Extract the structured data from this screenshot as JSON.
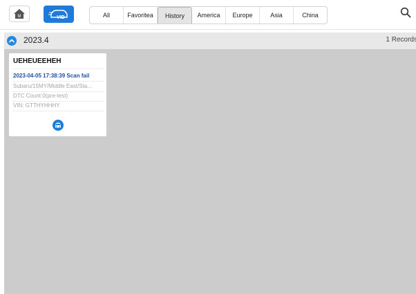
{
  "toolbar": {
    "home_icon_text": "M",
    "vid_label": "VID",
    "tabs": [
      {
        "label": "All"
      },
      {
        "label": "Favoritea"
      },
      {
        "label": "History"
      },
      {
        "label": "America"
      },
      {
        "label": "Europe"
      },
      {
        "label": "Asia"
      },
      {
        "label": "China"
      }
    ],
    "active_tab": "History",
    "icons": {
      "search": "search-icon",
      "home": "home-icon",
      "vid": "vid-car-icon"
    }
  },
  "group": {
    "title": "2023.4",
    "count": "1 Records",
    "icon": "chevron-up-icon"
  },
  "card": {
    "title": "UEHEUEEHEH",
    "scan_line": "2023-04-05 17:38:39 Scan fail",
    "vehicle_line": "Subaru/15MY/Middle East/Sta...",
    "dtc_line": "DTC Count:0(pre-test)",
    "vin_line": "VIN: GTTHYHHHY",
    "action_icon": "car-icon"
  },
  "colors": {
    "accent": "#1f7bd9",
    "content_background": "#cccccc",
    "header_background": "#e8e8e8",
    "scan_text": "#1f4ea0"
  }
}
